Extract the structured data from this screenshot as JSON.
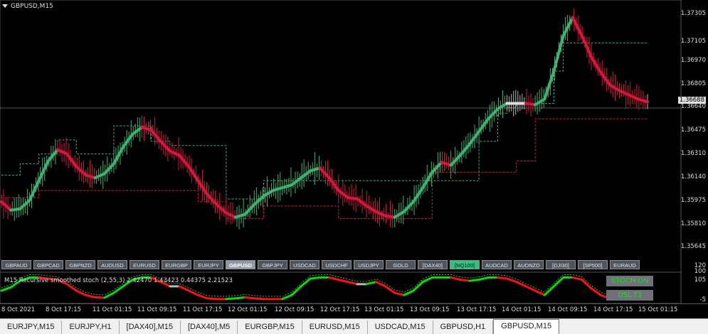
{
  "window": {
    "title": "GBPUSD,M15"
  },
  "price_axis": {
    "labels": [
      "1.37305",
      "1.37105",
      "1.36970",
      "1.36805",
      "1.36640",
      "1.36475",
      "1.36310",
      "1.36140",
      "1.35975",
      "1.35810",
      "1.35645"
    ],
    "current": "1.36688"
  },
  "symbol_buttons": [
    {
      "label": "GBPAUD",
      "state": "normal"
    },
    {
      "label": "GBPCAD",
      "state": "normal"
    },
    {
      "label": "GBPNZD",
      "state": "normal"
    },
    {
      "label": "AUDUSD",
      "state": "normal"
    },
    {
      "label": "EURUSD",
      "state": "normal"
    },
    {
      "label": "EURGBP",
      "state": "normal"
    },
    {
      "label": "EURJPY",
      "state": "normal"
    },
    {
      "label": "GBPUSD",
      "state": "active"
    },
    {
      "label": "GBPJPY",
      "state": "normal"
    },
    {
      "label": "USDCAD",
      "state": "normal"
    },
    {
      "label": "USDCHF",
      "state": "normal"
    },
    {
      "label": "USDJPY",
      "state": "normal"
    },
    {
      "label": "GOLD",
      "state": "normal"
    },
    {
      "label": "[DAX40]",
      "state": "normal"
    },
    {
      "label": "[NQ100]",
      "state": "green"
    },
    {
      "label": "AUDCAD",
      "state": "normal"
    },
    {
      "label": "AUDNZD",
      "state": "normal"
    },
    {
      "label": "[DJI30]",
      "state": "normal"
    },
    {
      "label": "[SP500]",
      "state": "normal"
    },
    {
      "label": "EURAUD",
      "state": "normal"
    }
  ],
  "sub_window": {
    "label": "M15  Recursive smoothed stoch (2,55,3) 2.42470 1.43423 0.44375 2.21523",
    "scale": [
      "120",
      "100",
      "105",
      "-5"
    ],
    "badges": {
      "stoch": "STOCH ON",
      "dsl": "DSL T3"
    }
  },
  "time_axis": [
    "8 Oct 2021",
    "8 Oct 17:15",
    "11 Oct 01:15",
    "11 Oct 09:15",
    "11 Oct 17:15",
    "12 Oct 01:15",
    "12 Oct 09:15",
    "12 Oct 17:15",
    "13 Oct 01:15",
    "13 Oct 09:15",
    "13 Oct 17:15",
    "14 Oct 01:15",
    "14 Oct 09:15",
    "14 Oct 17:15",
    "15 Oct 01:15"
  ],
  "tabs": [
    {
      "label": "EURJPY,M15"
    },
    {
      "label": "EURJPY,H1"
    },
    {
      "label": "[DAX40],M15"
    },
    {
      "label": "[DAX40],M5"
    },
    {
      "label": "EURGBP,M15"
    },
    {
      "label": "EURUSD,M15"
    },
    {
      "label": "USDCAD,M15"
    },
    {
      "label": "GBPUSD,H1"
    },
    {
      "label": "GBPUSD,M15",
      "active": true
    }
  ],
  "colors": {
    "up": "#3cb371",
    "down": "#dc143c",
    "neutral": "#bbbbbb",
    "stoch_up": "#00e000",
    "stoch_down": "#ff1010"
  },
  "chart_data": {
    "type": "line",
    "title": "GBPUSD,M15",
    "ylim": [
      1.3556,
      1.3738
    ],
    "smoothed_close": [
      1.3597,
      1.3591,
      1.3592,
      1.3598,
      1.3612,
      1.3626,
      1.3634,
      1.3631,
      1.3622,
      1.3616,
      1.3614,
      1.3617,
      1.3624,
      1.3636,
      1.3645,
      1.365,
      1.3648,
      1.364,
      1.3633,
      1.363,
      1.3622,
      1.3612,
      1.3602,
      1.3595,
      1.3589,
      1.3586,
      1.3588,
      1.3595,
      1.3601,
      1.3605,
      1.3607,
      1.3609,
      1.3614,
      1.3619,
      1.3621,
      1.3614,
      1.3605,
      1.36,
      1.3599,
      1.3594,
      1.359,
      1.3587,
      1.3586,
      1.359,
      1.3597,
      1.3607,
      1.3618,
      1.3625,
      1.3623,
      1.363,
      1.3638,
      1.3647,
      1.3656,
      1.3663,
      1.3667,
      1.3667,
      1.3667,
      1.3666,
      1.367,
      1.369,
      1.3715,
      1.3728,
      1.3715,
      1.37,
      1.3689,
      1.368,
      1.3676,
      1.3673,
      1.367,
      1.3668
    ],
    "dsl_upper": [
      1.3616,
      1.3616,
      1.3624,
      1.3624,
      1.3631,
      1.3631,
      1.3641,
      1.3641,
      1.3631,
      1.3631,
      1.3631,
      1.3631,
      1.3651,
      1.3651,
      1.3651,
      1.3651,
      1.364,
      1.364,
      1.3637,
      1.3637,
      1.3637,
      1.3637,
      1.3637,
      1.3637,
      1.3599,
      1.3599,
      1.3599,
      1.3599,
      1.3612,
      1.3612,
      1.3612,
      1.3612,
      1.3612,
      1.3612,
      1.3612,
      1.3612,
      1.3612,
      1.3612,
      1.3612,
      1.3612,
      1.3612,
      1.3612,
      1.3612,
      1.3612,
      1.3612,
      1.3612,
      1.3612,
      1.3612,
      1.3612,
      1.3612,
      1.3612,
      1.364,
      1.364,
      1.366,
      1.3664,
      1.3667,
      1.3667,
      1.3667,
      1.3667,
      1.369,
      1.371,
      1.371,
      1.371,
      1.371,
      1.371,
      1.371,
      1.371,
      1.371,
      1.371,
      1.371
    ],
    "dsl_lower": [
      1.36,
      1.36,
      1.36,
      1.36,
      1.3605,
      1.3605,
      1.3605,
      1.3605,
      1.3605,
      1.3605,
      1.3605,
      1.3605,
      1.3605,
      1.3605,
      1.3605,
      1.3605,
      1.3605,
      1.3605,
      1.3605,
      1.3605,
      1.3605,
      1.3597,
      1.3597,
      1.3597,
      1.3585,
      1.3585,
      1.3585,
      1.3585,
      1.3594,
      1.3594,
      1.3594,
      1.3594,
      1.3594,
      1.3594,
      1.3594,
      1.3594,
      1.3585,
      1.3585,
      1.3585,
      1.3585,
      1.3585,
      1.3585,
      1.3585,
      1.3585,
      1.3585,
      1.3585,
      1.3618,
      1.3618,
      1.3618,
      1.3618,
      1.3618,
      1.3618,
      1.3618,
      1.3618,
      1.3618,
      1.3626,
      1.3626,
      1.3656,
      1.3656,
      1.3656,
      1.3656,
      1.3656,
      1.3656,
      1.3656,
      1.3656,
      1.3656,
      1.3656,
      1.3656,
      1.3656,
      1.3656
    ],
    "stoch": [
      40,
      55,
      85,
      100,
      100,
      95,
      90,
      70,
      40,
      20,
      10,
      8,
      30,
      60,
      90,
      100,
      100,
      80,
      60,
      60,
      40,
      20,
      5,
      2,
      2,
      5,
      10,
      5,
      2,
      2,
      2,
      20,
      60,
      95,
      100,
      100,
      90,
      80,
      70,
      70,
      80,
      60,
      30,
      20,
      40,
      80,
      100,
      100,
      100,
      90,
      85,
      90,
      100,
      100,
      95,
      80,
      60,
      40,
      20,
      60,
      100,
      100,
      90,
      50,
      20,
      5,
      3,
      3,
      3,
      3
    ],
    "xlabels": [
      "8 Oct 2021",
      "8 Oct 17:15",
      "11 Oct 01:15",
      "11 Oct 09:15",
      "11 Oct 17:15",
      "12 Oct 01:15",
      "12 Oct 09:15",
      "12 Oct 17:15",
      "13 Oct 01:15",
      "13 Oct 09:15",
      "13 Oct 17:15",
      "14 Oct 01:15",
      "14 Oct 09:15",
      "14 Oct 17:15",
      "15 Oct 01:15"
    ]
  }
}
